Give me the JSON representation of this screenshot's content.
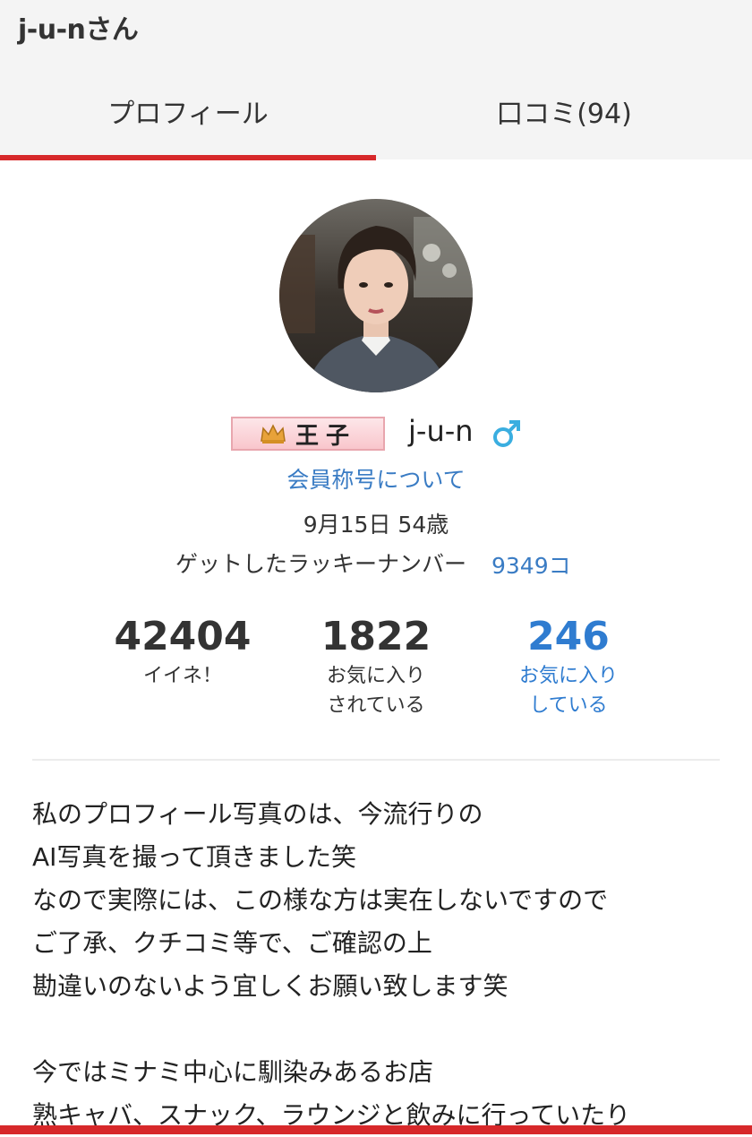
{
  "header": {
    "title": "j-u-nさん",
    "tabs": [
      {
        "label": "プロフィール",
        "active": true
      },
      {
        "label": "口コミ(94)",
        "active": false
      }
    ],
    "accent_color": "#d7282a"
  },
  "profile": {
    "avatar_alt": "avatar-photo",
    "badge": {
      "icon": "crown-icon",
      "text": "王子"
    },
    "username": "j-u-n",
    "gender_icon": "male-icon",
    "title_link": "会員称号について",
    "birth": "9月15日 54歳",
    "lucky_label": "ゲットしたラッキーナンバー",
    "lucky_value": "9349コ",
    "link_color": "#3a7cc4"
  },
  "stats": [
    {
      "value": "42404",
      "label": "イイネ！"
    },
    {
      "value": "1822",
      "label": "お気に入り\nされている"
    },
    {
      "value": "246",
      "label": "お気に入り\nしている"
    }
  ],
  "bio": [
    "私のプロフィール写真のは、今流行りの",
    "AI写真を撮って頂きました笑",
    "なので実際には、この様な方は実在しないですので",
    "ご了承、クチコミ等で、ご確認の上",
    "勘違いのないよう宜しくお願い致します笑",
    "",
    "今ではミナミ中心に馴染みあるお店",
    "熟キャバ、スナック、ラウンジと飲みに行っていたり"
  ]
}
